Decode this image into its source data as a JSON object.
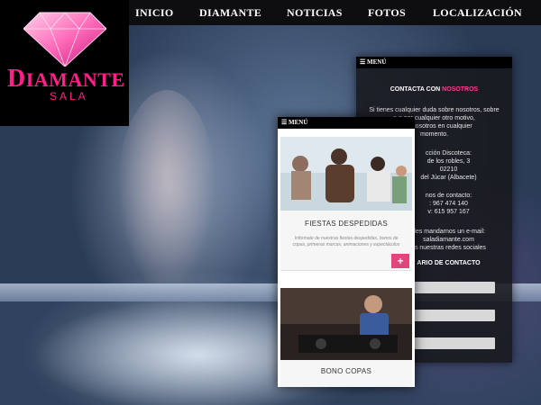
{
  "nav": {
    "items": [
      "INICIO",
      "DIAMANTE",
      "NOTICIAS",
      "FOTOS",
      "LOCALIZACIÓN"
    ]
  },
  "logo": {
    "brand": "IAMANTE",
    "brand_initial": "D",
    "sub": "SALA"
  },
  "contact_panel": {
    "menu_label": "MENÚ",
    "title_prefix": "CONTACTA CON ",
    "title_highlight": "NOSOTROS",
    "intro": "Si tienes cualquier duda sobre nosotros, sobre\na o por cualquier otro motivo,\nr con nosotros en cualquier\nmomento.",
    "address": "cción Discoteca:\nde los robles, 3\n02210\ndel Júcar (Albacete)",
    "phones": "nos de contacto:\n: 967 474 140\nv: 615 957 167",
    "email": "des mandarnos un e-mail:\nsaladiamante.com\nes nuestras redes sociales",
    "form_label": "ARIO DE CONTACTO"
  },
  "front_panel": {
    "menu_label": "MENÚ",
    "cards": [
      {
        "title": "FIESTAS DESPEDIDAS",
        "desc": "Infórmate de nuestras fiestas despedidas, bonos de copas, primeras marcas, animaciones y espectáculos",
        "plus": "+"
      },
      {
        "title": "BONO COPAS"
      }
    ]
  },
  "colors": {
    "accent_pink": "#ff1f8a",
    "plus_pink": "#e2457b",
    "nav_bg": "#0e0e10"
  }
}
